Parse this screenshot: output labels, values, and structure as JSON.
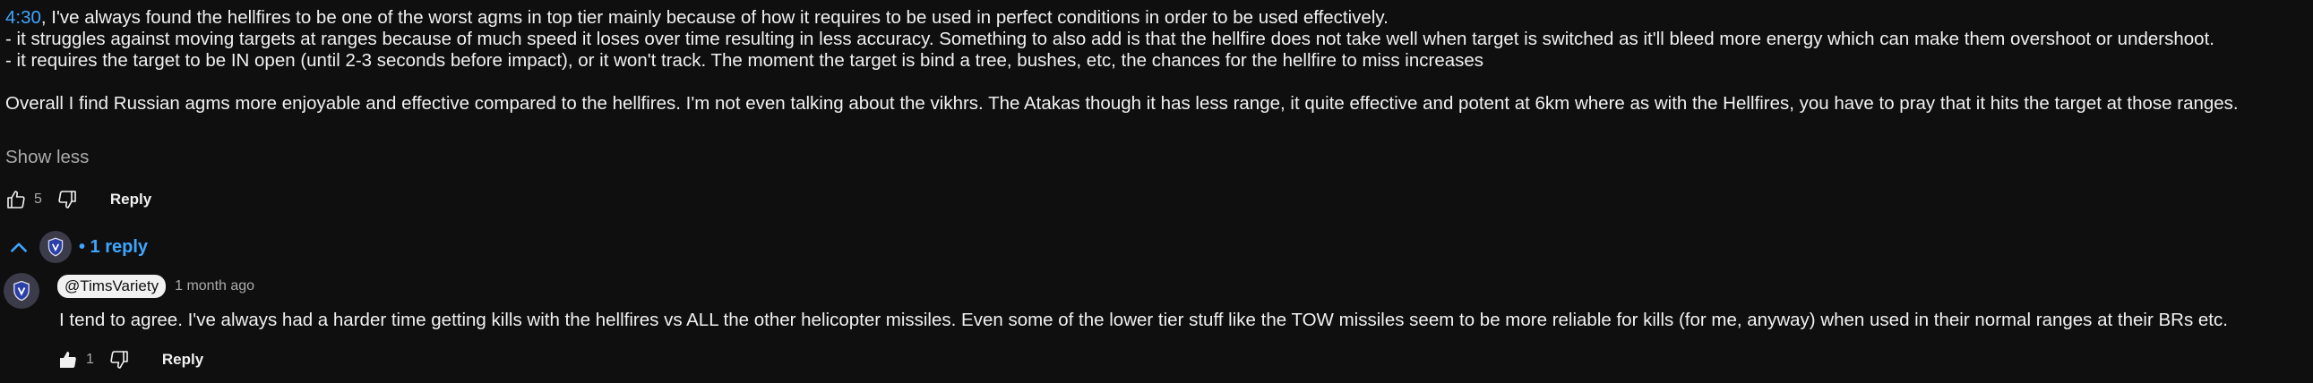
{
  "comment": {
    "timestamp_link": "4:30",
    "line1_rest": ", I've always found the hellfires to be one of the worst agms in top tier mainly because of how it requires to be used in perfect conditions in order to be used effectively.",
    "line2": "- it struggles against moving targets at ranges because of much speed it loses over time resulting in less accuracy. Something to also add is that the hellfire does not take well when target is switched as it'll bleed more energy which can make them overshoot or undershoot.",
    "line3": "- it requires the target to be IN open (until 2-3 seconds before impact), or it won't track. The moment the target is bind a tree, bushes, etc, the chances for the hellfire to miss increases",
    "line5": "Overall I find Russian agms more enjoyable and effective compared to the hellfires. I'm not even talking about the vikhrs. The Atakas though it has less range, it quite effective and potent at 6km where as with the Hellfires, you have to pray that it hits the target at those ranges.",
    "show_less": "Show less",
    "like_count": "5",
    "reply_label": "Reply",
    "like_icon": "thumb-up-outline-icon",
    "dislike_icon": "thumb-down-outline-icon"
  },
  "replies_toggle": {
    "label": "• 1 reply",
    "chevron_icon": "chevron-up-icon",
    "accent": "#3ea6ff"
  },
  "reply": {
    "author": "@TimsVariety",
    "time": "1 month ago",
    "text": "I tend to agree. I've always had a harder time getting kills with the hellfires vs ALL the other helicopter missiles. Even some of the lower tier stuff like the TOW missiles seem to be more reliable for kills (for me, anyway) when used in their normal ranges at their BRs etc.",
    "like_count": "1",
    "reply_label": "Reply",
    "like_icon": "thumb-up-filled-icon",
    "dislike_icon": "thumb-down-outline-icon"
  }
}
